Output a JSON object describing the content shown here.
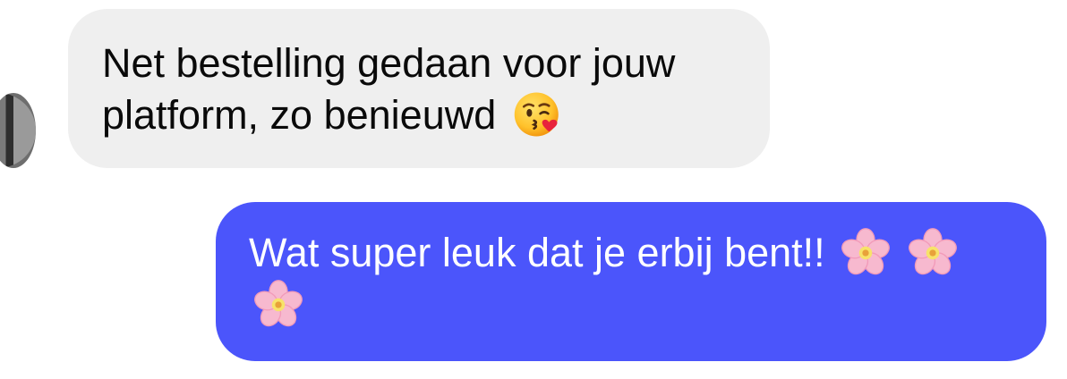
{
  "conversation": {
    "received_message": {
      "text": "Net bestelling gedaan voor jouw platform, zo benieuwd",
      "emoji": "kissing-face-with-heart-icon"
    },
    "sent_message": {
      "text": "Wat super leuk dat je erbij bent!!",
      "emojis": [
        "cherry-blossom-icon",
        "cherry-blossom-icon",
        "cherry-blossom-icon"
      ]
    }
  },
  "colors": {
    "received_bubble": "#efefef",
    "sent_bubble": "#4b55fb",
    "received_text": "#0a0a0a",
    "sent_text": "#ffffff"
  }
}
